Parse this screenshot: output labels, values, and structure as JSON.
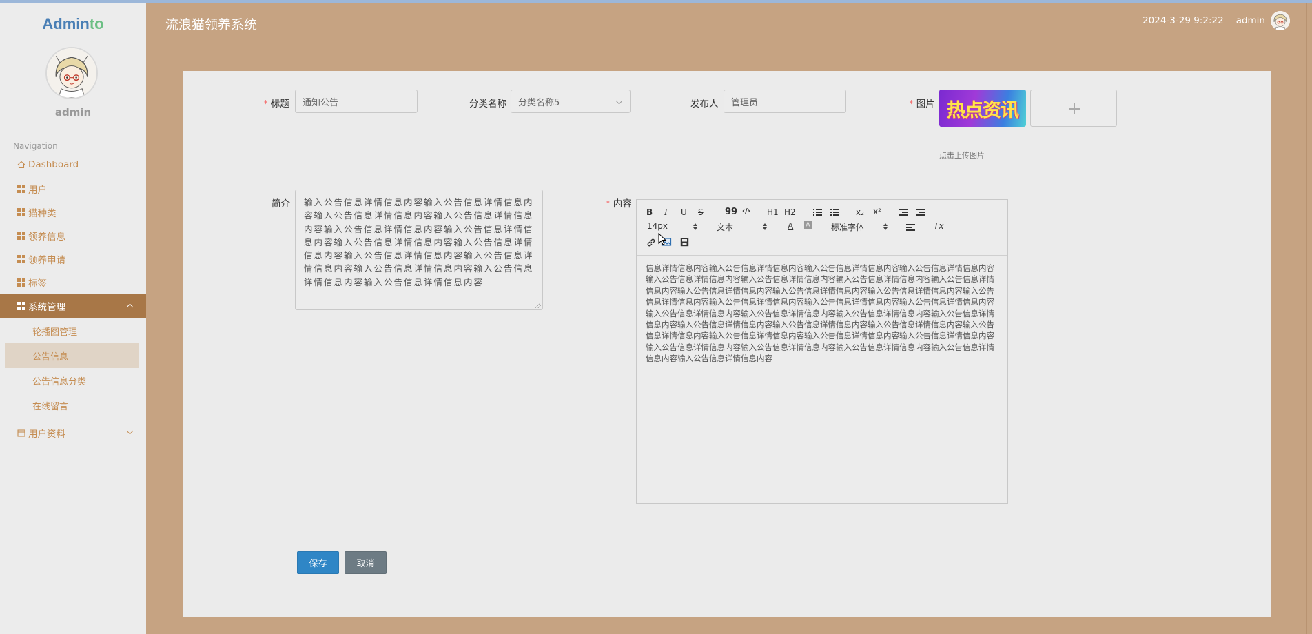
{
  "app": {
    "logo_main": "Admin",
    "logo_accent": "to",
    "title": "流浪猫领养系统"
  },
  "header": {
    "datetime": "2024-3-29 9:2:22",
    "username": "admin"
  },
  "sidebar": {
    "username": "admin",
    "nav_title": "Navigation",
    "items": [
      {
        "label": "Dashboard",
        "icon": "home-icon"
      },
      {
        "label": "用户",
        "icon": "grid-icon"
      },
      {
        "label": "猫种类",
        "icon": "grid-icon"
      },
      {
        "label": "领养信息",
        "icon": "grid-icon"
      },
      {
        "label": "领养申请",
        "icon": "grid-icon"
      },
      {
        "label": "标签",
        "icon": "grid-icon"
      },
      {
        "label": "系统管理",
        "icon": "grid-icon",
        "expanded": true
      },
      {
        "label": "用户资料",
        "icon": "calendar-icon",
        "expanded": false
      }
    ],
    "sub_items": [
      {
        "label": "轮播图管理"
      },
      {
        "label": "公告信息",
        "active": true
      },
      {
        "label": "公告信息分类"
      },
      {
        "label": "在线留言"
      }
    ]
  },
  "form": {
    "title_label": "标题",
    "title_value": "通知公告",
    "category_label": "分类名称",
    "category_value": "分类名称5",
    "publisher_label": "发布人",
    "publisher_value": "管理员",
    "image_label": "图片",
    "image_text": "热点资讯",
    "upload_hint": "点击上传图片",
    "intro_label": "简介",
    "intro_value": "输入公告信息详情信息内容输入公告信息详情信息内容输入公告信息详情信息内容输入公告信息详情信息内容输入公告信息详情信息内容输入公告信息详情信息内容输入公告信息详情信息内容输入公告信息详情信息内容输入公告信息详情信息内容输入公告信息详情信息内容输入公告信息详情信息内容输入公告信息详情信息内容输入公告信息详情信息内容",
    "content_label": "内容",
    "content_value": "信息详情信息内容输入公告信息详情信息内容输入公告信息详情信息内容输入公告信息详情信息内容输入公告信息详情信息内容输入公告信息详情信息内容输入公告信息详情信息内容输入公告信息详情信息内容输入公告信息详情信息内容输入公告信息详情信息内容输入公告信息详情信息内容输入公告信息详情信息内容输入公告信息详情信息内容输入公告信息详情信息内容输入公告信息详情信息内容输入公告信息详情信息内容输入公告信息详情信息内容输入公告信息详情信息内容输入公告信息详情信息内容输入公告信息详情信息内容输入公告信息详情信息内容输入公告信息详情信息内容输入公告信息详情信息内容输入公告信息详情信息内容输入公告信息详情信息内容输入公告信息详情信息内容输入公告信息详情信息内容输入公告信息详情信息内容输入公告信息详情信息内容输入公告信息详情信息内容输入公告信息详情信息内容",
    "save_label": "保存",
    "cancel_label": "取消"
  },
  "editor": {
    "font_size": "14px",
    "paragraph": "文本",
    "font_family": "标准字体",
    "btn_bold": "B",
    "btn_italic": "I",
    "btn_underline": "U",
    "btn_strike": "S",
    "btn_quote": "99",
    "btn_code": "‹/›",
    "btn_h1": "H1",
    "btn_h2": "H2",
    "btn_sub": "x₂",
    "btn_sup": "x²",
    "btn_color": "A",
    "btn_bg": "A",
    "btn_clean": "Tx"
  },
  "colors": {
    "background": "#c6a382",
    "sidebar_active": "#a87747",
    "nav_text": "#c58d52",
    "save_button": "#2f86c6",
    "cancel_button": "#6d7b84",
    "required": "#f56c6c"
  }
}
